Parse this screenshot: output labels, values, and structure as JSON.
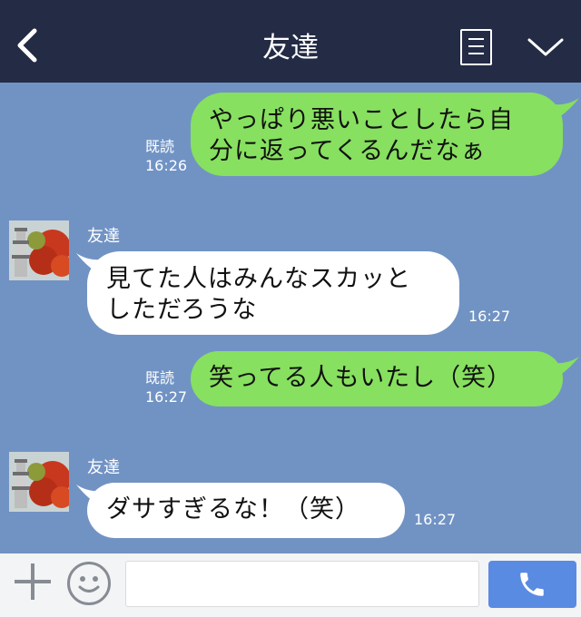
{
  "header": {
    "title": "友達",
    "back_icon": "chevron-left-icon",
    "menu_icon": "list-menu-icon",
    "collapse_icon": "chevron-down-icon"
  },
  "messages": [
    {
      "direction": "outgoing",
      "lines": [
        "やっぱり悪いことしたら自",
        "分に返ってくるんだなぁ"
      ],
      "read": "既読",
      "time": "16:26"
    },
    {
      "direction": "incoming",
      "sender": "友達",
      "lines": [
        "見てた人はみんなスカッと",
        "しただろうな"
      ],
      "time": "16:27"
    },
    {
      "direction": "outgoing",
      "lines": [
        "笑ってる人もいたし（笑）"
      ],
      "read": "既読",
      "time": "16:27"
    },
    {
      "direction": "incoming",
      "sender": "友達",
      "lines": [
        "ダサすぎるな！（笑）"
      ],
      "time": "16:27"
    }
  ],
  "footer": {
    "plus_icon": "plus-icon",
    "emoji_icon": "smiley-icon",
    "input_value": "",
    "call_icon": "phone-icon"
  },
  "colors": {
    "header_bg": "#232b45",
    "chat_bg": "#7193c4",
    "outgoing_bubble": "#87e05f",
    "incoming_bubble": "#ffffff",
    "call_button": "#5a8be2"
  }
}
